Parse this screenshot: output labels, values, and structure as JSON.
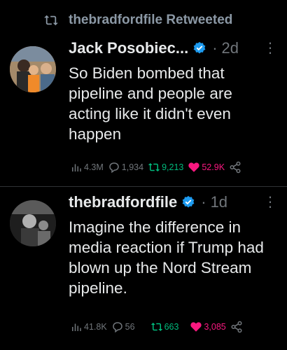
{
  "retweet_header": {
    "icon": "retweet-icon",
    "text": "thebradfordfile Retweeted"
  },
  "tweets": [
    {
      "author": "Jack Posobiec...",
      "verified": true,
      "time": "2d",
      "text": "So Biden bombed that pipeline and people are acting like it didn't even happen",
      "stats": {
        "views": "4.3M",
        "replies": "1,934",
        "retweets": "9,213",
        "likes": "52.9K"
      }
    },
    {
      "author": "thebradfordfile",
      "verified": true,
      "time": "1d",
      "text": "Imagine the difference in media reaction if Trump had blown up the Nord Stream pipeline.",
      "stats": {
        "views": "41.8K",
        "replies": "56",
        "retweets": "663",
        "likes": "3,085"
      }
    }
  ],
  "colors": {
    "background": "#000000",
    "text": "#e7e9ea",
    "muted": "#71767b",
    "verified": "#1d9bf0",
    "retweet": "#00ba7c",
    "like": "#f91880"
  }
}
